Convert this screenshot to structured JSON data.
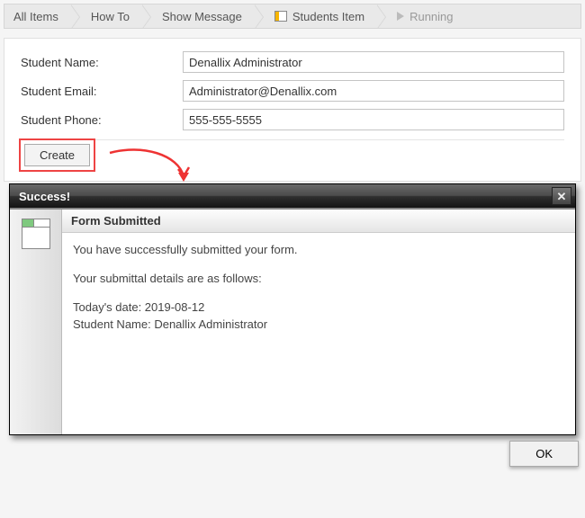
{
  "breadcrumb": {
    "items": [
      {
        "label": "All Items"
      },
      {
        "label": "How To"
      },
      {
        "label": "Show Message"
      },
      {
        "label": "Students Item",
        "icon": "students-item-icon"
      },
      {
        "label": "Running",
        "icon": "running-icon",
        "muted": true
      }
    ]
  },
  "form": {
    "name_label": "Student Name:",
    "name_value": "Denallix Administrator",
    "email_label": "Student Email:",
    "email_value": "Administrator@Denallix.com",
    "phone_label": "Student Phone:",
    "phone_value": "555-555-5555",
    "create_label": "Create"
  },
  "dialog": {
    "title": "Success!",
    "subtitle": "Form Submitted",
    "line1": "You have successfully submitted your form.",
    "line2": "Your submittal details are as follows:",
    "line3": "Today's date: 2019-08-12",
    "line4": "Student Name: Denallix Administrator",
    "ok_label": "OK"
  }
}
